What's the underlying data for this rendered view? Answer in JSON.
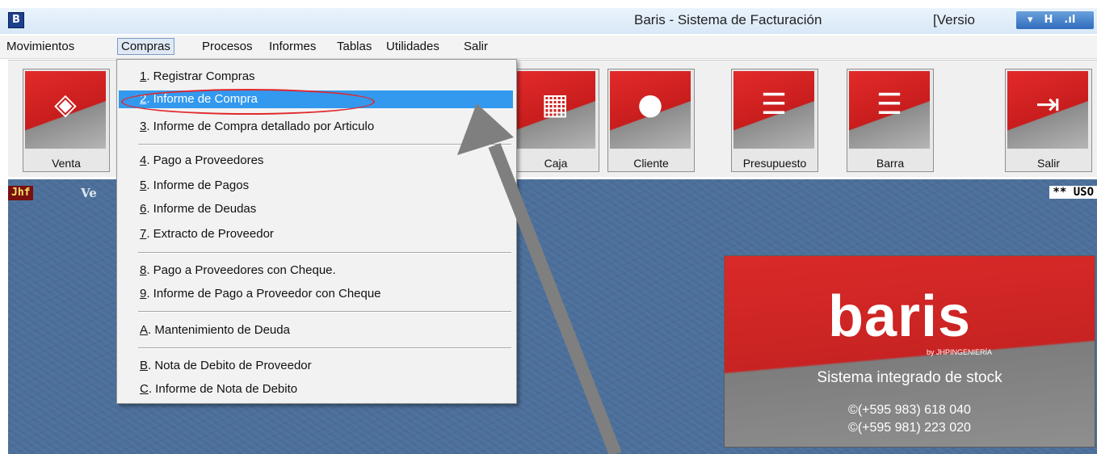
{
  "window": {
    "icon_letter": "B",
    "title": "Baris - Sistema de Facturación",
    "version_text": "[Versio",
    "controls_glyphs": [
      "▾",
      "H",
      ".ıl"
    ]
  },
  "menubar": {
    "items": [
      "Movimientos",
      "Compras",
      "Procesos",
      "Informes",
      "Tablas",
      "Utilidades",
      "Salir"
    ],
    "active": "Compras"
  },
  "toolbar": {
    "buttons": [
      {
        "label": "Venta",
        "icon": "tag-icon"
      },
      {
        "label": "Caja",
        "icon": "cash-register-icon"
      },
      {
        "label": "Cliente",
        "icon": "people-icon"
      },
      {
        "label": "Presupuesto",
        "icon": "invoice-hand-icon"
      },
      {
        "label": "Barra",
        "icon": "invoice-hand-icon"
      },
      {
        "label": "Salir",
        "icon": "exit-icon"
      }
    ]
  },
  "compras_menu": {
    "items": [
      {
        "key": "1",
        "rest": ". Registrar Compras"
      },
      {
        "key": "2",
        "rest": ". Informe de Compra"
      },
      {
        "key": "3",
        "rest": ". Informe de Compra detallado por Articulo"
      },
      {
        "key": "4",
        "rest": ". Pago a Proveedores"
      },
      {
        "key": "5",
        "rest": ". Informe de Pagos"
      },
      {
        "key": "6",
        "rest": ". Informe de Deudas"
      },
      {
        "key": "7",
        "rest": ". Extracto de Proveedor"
      },
      {
        "key": "8",
        "rest": ". Pago a Proveedores con Cheque."
      },
      {
        "key": "9",
        "rest": ". Informe de Pago a Proveedor con Cheque"
      },
      {
        "key": "A",
        "rest": ". Mantenimiento de Deuda"
      },
      {
        "key": "B",
        "rest": ". Nota de Debito de Proveedor"
      },
      {
        "key": "C",
        "rest": ". Informe de Nota de Debito"
      }
    ],
    "highlighted": "2. Informe de Compra"
  },
  "desktop": {
    "badge": "Jhf",
    "left_text": "Ve",
    "right_text": "** USO"
  },
  "brand": {
    "logo": "baris",
    "by_line": "by JHPINGENIERÍA",
    "tagline": "Sistema integrado de stock",
    "phone1": "©(+595 983) 618 040",
    "phone2": "©(+595 981) 223 020"
  },
  "colors": {
    "accent_red": "#d92a28",
    "highlight_blue": "#3399ee",
    "desktop_blue": "#4b6f9a"
  }
}
